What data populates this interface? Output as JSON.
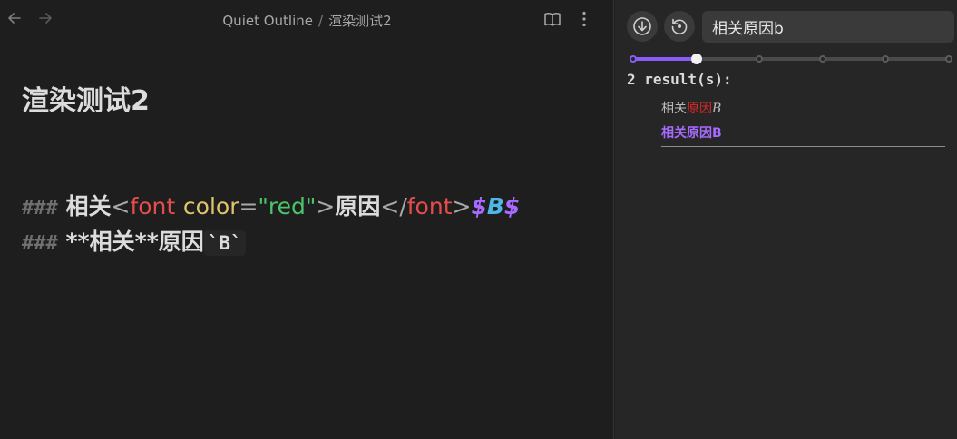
{
  "editor": {
    "breadcrumb": {
      "parent": "Quiet Outline",
      "separator": "/",
      "current": "渲染测试2"
    },
    "title": "渲染测试2",
    "line1": {
      "hashes": "###",
      "text1": "相关",
      "lt1": "<",
      "tag1": "font",
      "attr": "color",
      "eq": "=",
      "value": "\"red\"",
      "gt1": ">",
      "text2": "原因",
      "lt2": "</",
      "tag2": "font",
      "gt2": ">",
      "math_open": "$",
      "math_var": "B",
      "math_close": "$"
    },
    "line2": {
      "hashes": "###",
      "bold_text": "**相关**原因",
      "code": "`B`"
    }
  },
  "outline": {
    "search_value": "相关原因b",
    "result_count": "2 result(s):",
    "results": [
      {
        "plain": "相关",
        "red": "原因",
        "math": "B"
      },
      {
        "text": "相关原因B"
      }
    ],
    "slider": {
      "level": 2,
      "levels": 6
    },
    "colors": {
      "accent": "#8b5cf6",
      "red": "#e02828"
    }
  }
}
